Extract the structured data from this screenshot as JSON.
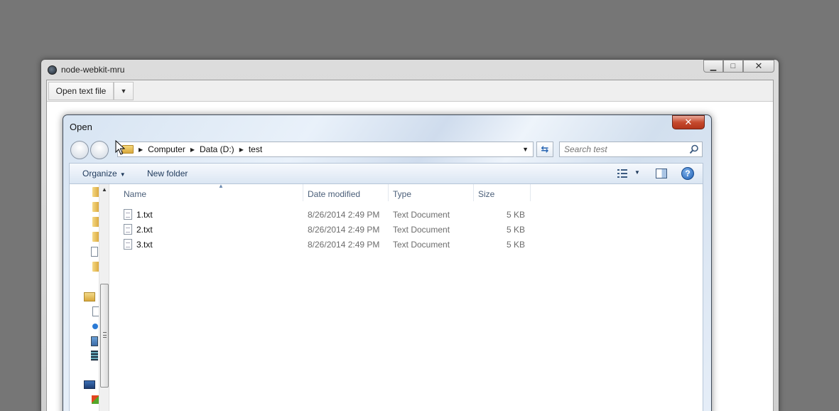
{
  "app": {
    "title": "node-webkit-mru",
    "toolbar": {
      "open_label": "Open text file",
      "dropdown_glyph": "▼"
    },
    "controls": {
      "minimize": "▁",
      "maximize": "□",
      "close": "✕"
    }
  },
  "dialog": {
    "title": "Open",
    "close_glyph": "✕",
    "breadcrumb": [
      "Computer",
      "Data (D:)",
      "test"
    ],
    "search": {
      "placeholder": "Search test",
      "value": ""
    },
    "commands": {
      "organize": "Organize",
      "new_folder": "New folder",
      "help": "?"
    },
    "columns": {
      "name": "Name",
      "date": "Date modified",
      "type": "Type",
      "size": "Size"
    },
    "files": [
      {
        "name": "1.txt",
        "date": "8/26/2014 2:49 PM",
        "type": "Text Document",
        "size": "5 KB"
      },
      {
        "name": "2.txt",
        "date": "8/26/2014 2:49 PM",
        "type": "Text Document",
        "size": "5 KB"
      },
      {
        "name": "3.txt",
        "date": "8/26/2014 2:49 PM",
        "type": "Text Document",
        "size": "5 KB"
      }
    ],
    "nav_icons": [
      "folder-icon",
      "folder-icon",
      "folder-icon",
      "folder-icon",
      "document-window-icon",
      "folder-icon",
      "libraries-icon",
      "documents-icon",
      "music-icon",
      "pictures-icon",
      "videos-icon",
      "computer-icon",
      "windows-drive-icon"
    ]
  },
  "colors": {
    "desktop": "#767676",
    "dialog_accent": "#1e395b",
    "close_red": "#c64a2e"
  }
}
